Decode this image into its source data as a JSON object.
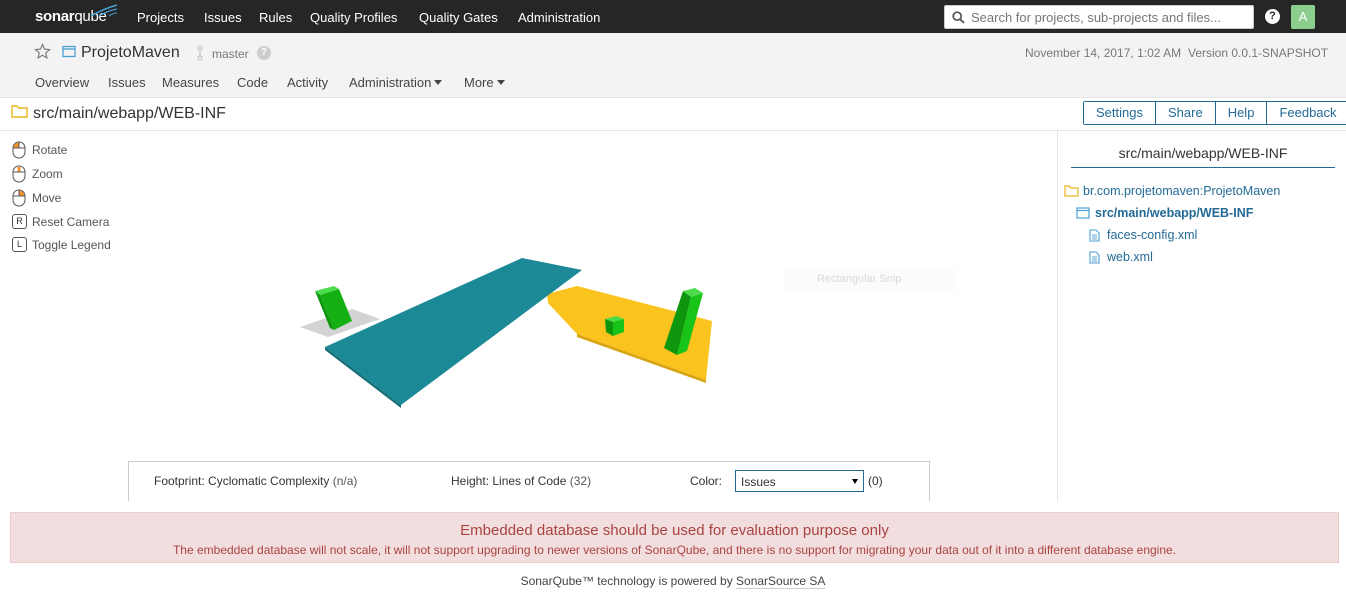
{
  "navbar": {
    "logo_bold": "sonar",
    "logo_light": "qube",
    "links": [
      "Projects",
      "Issues",
      "Rules",
      "Quality Profiles",
      "Quality Gates",
      "Administration"
    ],
    "search_placeholder": "Search for projects, sub-projects and files...",
    "help": "?",
    "avatar_letter": "A"
  },
  "project": {
    "name": "ProjetoMaven",
    "branch": "master",
    "date": "November 14, 2017, 1:02 AM",
    "version": "Version 0.0.1-SNAPSHOT",
    "tabs": [
      "Overview",
      "Issues",
      "Measures",
      "Code",
      "Activity",
      "Administration",
      "More"
    ]
  },
  "toolbar": {
    "path": "src/main/webapp/WEB-INF",
    "buttons": [
      "Settings",
      "Share",
      "Help",
      "Feedback"
    ]
  },
  "controls": [
    {
      "label": "Rotate",
      "icon": "mouse-left-icon"
    },
    {
      "label": "Zoom",
      "icon": "mouse-scroll-icon"
    },
    {
      "label": "Move",
      "icon": "mouse-right-icon"
    },
    {
      "label": "Reset Camera",
      "key": "R"
    },
    {
      "label": "Toggle Legend",
      "key": "L"
    }
  ],
  "ghost": {
    "label": "Rectangular Snip"
  },
  "legend": {
    "footprint_label": "Footprint: Cyclomatic Complexity",
    "footprint_value": "(n/a)",
    "height_label": "Height: Lines of Code",
    "height_value": "(32)",
    "color_label": "Color:",
    "color_selected": "Issues",
    "color_count": "(0)"
  },
  "tree": {
    "title": "src/main/webapp/WEB-INF",
    "items": [
      {
        "label": "br.com.projetomaven:ProjetoMaven",
        "type": "folder"
      },
      {
        "label": "src/main/webapp/WEB-INF",
        "type": "folder-open",
        "current": true
      },
      {
        "label": "faces-config.xml",
        "type": "file"
      },
      {
        "label": "web.xml",
        "type": "file"
      }
    ]
  },
  "scene_colors": {
    "teal": "#1b8a96",
    "gold": "#fbc31e",
    "green": "#19c419",
    "gray": "#d4d4d4"
  },
  "alert": {
    "title": "Embedded database should be used for evaluation purpose only",
    "text": "The embedded database will not scale, it will not support upgrading to newer versions of SonarQube, and there is no support for migrating your data out of it into a different database engine."
  },
  "footer": {
    "prefix": "SonarQube™ technology is powered by ",
    "link": "SonarSource SA"
  }
}
